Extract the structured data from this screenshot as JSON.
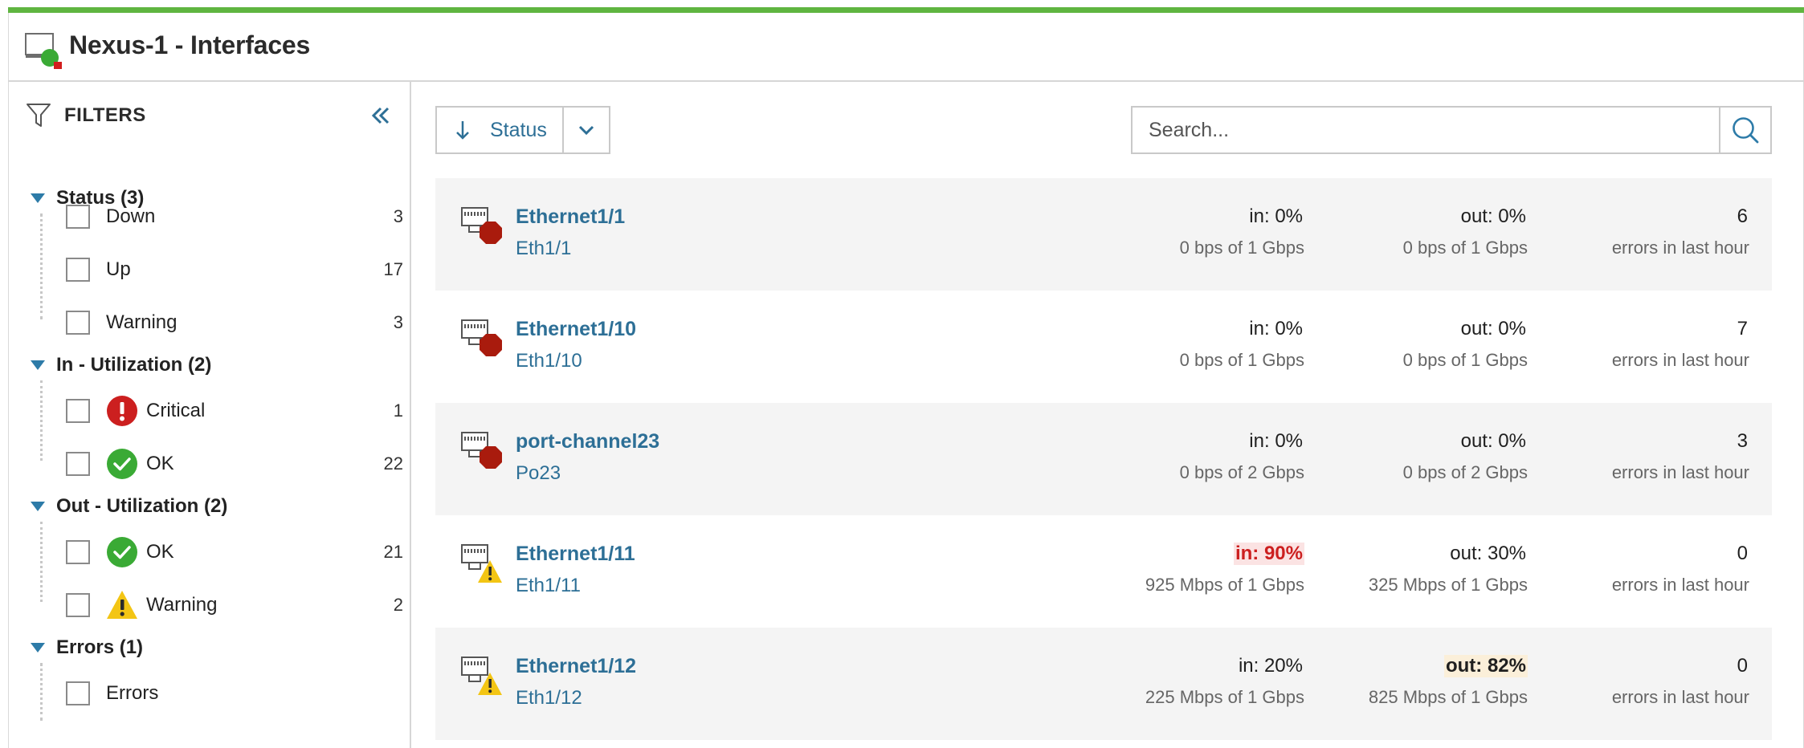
{
  "title": "Nexus-1 - Interfaces",
  "colors": {
    "accent_bar": "#5fb540",
    "link": "#2d6f96",
    "critical": "#cc1f1f",
    "down": "#a91b0d",
    "ok": "#3aaa35",
    "warning": "#f3c514"
  },
  "filters": {
    "label": "FILTERS",
    "collapse_icon": "double-chevron-left-icon",
    "groups": [
      {
        "title": "Status (3)",
        "items": [
          {
            "label": "Down",
            "count": "3"
          },
          {
            "label": "Up",
            "count": "17"
          },
          {
            "label": "Warning",
            "count": "3"
          }
        ]
      },
      {
        "title": "In - Utilization (2)",
        "items": [
          {
            "label": "Critical",
            "count": "1",
            "icon": "critical-icon"
          },
          {
            "label": "OK",
            "count": "22",
            "icon": "ok-icon"
          }
        ]
      },
      {
        "title": "Out - Utilization (2)",
        "items": [
          {
            "label": "OK",
            "count": "21",
            "icon": "ok-icon"
          },
          {
            "label": "Warning",
            "count": "2",
            "icon": "warning-icon"
          }
        ]
      },
      {
        "title": "Errors (1)",
        "items": [
          {
            "label": "Errors"
          }
        ]
      }
    ]
  },
  "toolbar": {
    "sort_label": "Status",
    "search_placeholder": "Search..."
  },
  "interfaces": [
    {
      "name": "Ethernet1/1",
      "short": "Eth1/1",
      "status": "down",
      "in": "in: 0%",
      "in_detail": "0 bps of 1 Gbps",
      "out": "out: 0%",
      "out_detail": "0 bps of 1 Gbps",
      "errors": "6",
      "errors_label": "errors in last hour"
    },
    {
      "name": "Ethernet1/10",
      "short": "Eth1/10",
      "status": "down",
      "in": "in: 0%",
      "in_detail": "0 bps of 1 Gbps",
      "out": "out: 0%",
      "out_detail": "0 bps of 1 Gbps",
      "errors": "7",
      "errors_label": "errors in last hour"
    },
    {
      "name": "port-channel23",
      "short": "Po23",
      "status": "down",
      "in": "in: 0%",
      "in_detail": "0 bps of 2 Gbps",
      "out": "out: 0%",
      "out_detail": "0 bps of 2 Gbps",
      "errors": "3",
      "errors_label": "errors in last hour"
    },
    {
      "name": "Ethernet1/11",
      "short": "Eth1/11",
      "status": "warning",
      "in": "in: 90%",
      "in_detail": "925 Mbps of 1 Gbps",
      "out": "out: 30%",
      "out_detail": "325 Mbps of 1 Gbps",
      "errors": "0",
      "errors_label": "errors in last hour"
    },
    {
      "name": "Ethernet1/12",
      "short": "Eth1/12",
      "status": "warning",
      "in": "in: 20%",
      "in_detail": "225 Mbps of 1 Gbps",
      "out": "out: 82%",
      "out_detail": "825 Mbps of 1 Gbps",
      "errors": "0",
      "errors_label": "errors in last hour"
    }
  ]
}
